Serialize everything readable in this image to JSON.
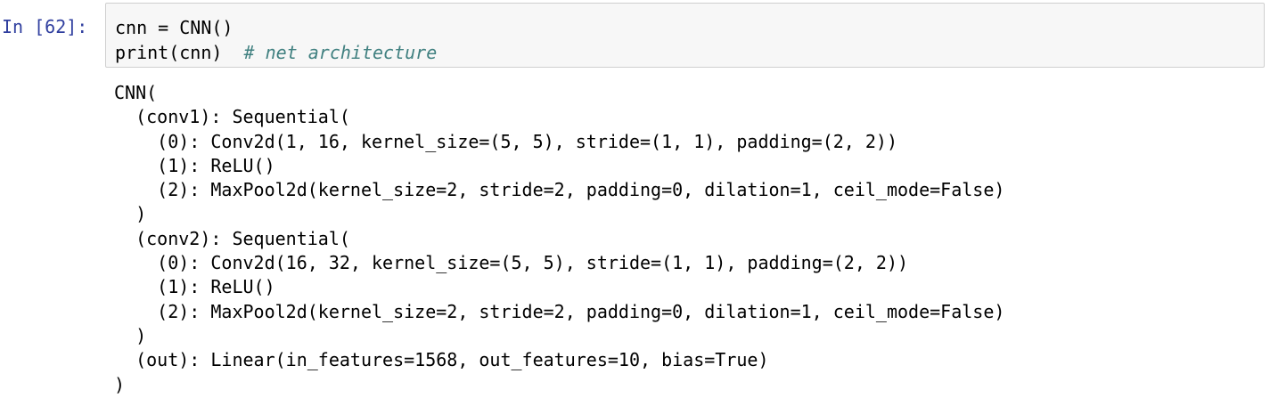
{
  "cell": {
    "prompt": "In [62]:",
    "input_lines": [
      {
        "code": "cnn = CNN()",
        "comment": ""
      },
      {
        "code": "print(cnn)  ",
        "comment": "# net architecture"
      }
    ],
    "output_lines": [
      "CNN(",
      "  (conv1): Sequential(",
      "    (0): Conv2d(1, 16, kernel_size=(5, 5), stride=(1, 1), padding=(2, 2))",
      "    (1): ReLU()",
      "    (2): MaxPool2d(kernel_size=2, stride=2, padding=0, dilation=1, ceil_mode=False)",
      "  )",
      "  (conv2): Sequential(",
      "    (0): Conv2d(16, 32, kernel_size=(5, 5), stride=(1, 1), padding=(2, 2))",
      "    (1): ReLU()",
      "    (2): MaxPool2d(kernel_size=2, stride=2, padding=0, dilation=1, ceil_mode=False)",
      "  )",
      "  (out): Linear(in_features=1568, out_features=10, bias=True)",
      ")"
    ]
  },
  "colors": {
    "prompt": "#303f9f",
    "input_background": "#f7f7f7",
    "input_border": "#cfcfcf",
    "comment": "#408080"
  }
}
